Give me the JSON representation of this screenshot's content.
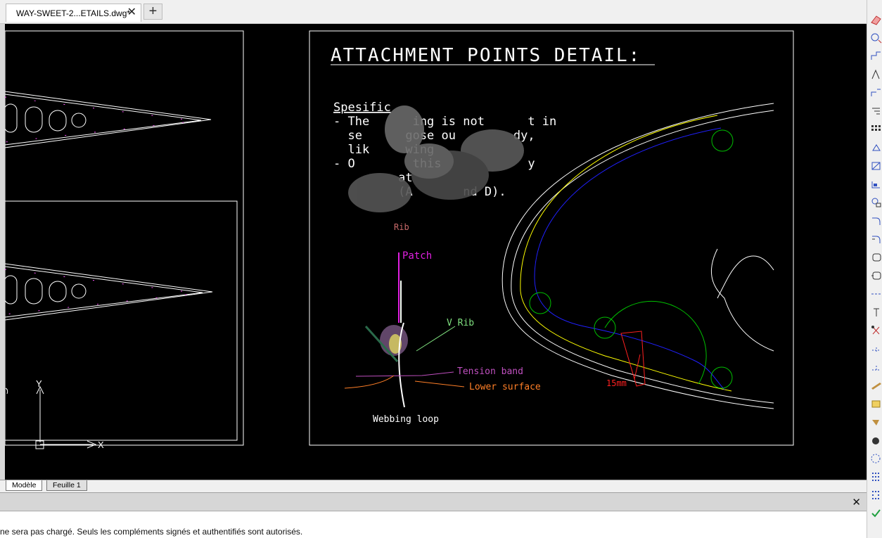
{
  "window": {
    "tab_title": "WAY-SWEET-2...ETAILS.dwg*",
    "close_glyph": "✕",
    "new_tab_glyph": "+"
  },
  "drawing": {
    "detail_title": "ATTACHMENT POINTS DETAIL:",
    "spec_heading": "Spesific",
    "spec_lines": [
      "- The      ing is not      t in",
      "  se      gose ou        dy,",
      "  lik     wing",
      "- O        this            y",
      "         at",
      "         (A       nd D)."
    ],
    "labels": {
      "rib": "Rib",
      "patch": "Patch",
      "v_rib": "V Rib",
      "tension_band": "Tension band",
      "lower_surface": "Lower surface",
      "webbing_loop": "Webbing loop",
      "dimension": "15mm"
    },
    "ucs": {
      "y_label": "Y",
      "x_label": "X"
    },
    "colors": {
      "background": "#000000",
      "outline": "#ffffff",
      "yellow": "#ffff00",
      "blue": "#2020ff",
      "green": "#00c000",
      "magenta": "#e020e0",
      "red": "#ff2020",
      "orange": "#ff7f27",
      "rib_label": "#c86a6a",
      "v_rib_label": "#7fe07f",
      "tension_label": "#c050c0"
    }
  },
  "layout_tabs": {
    "model": "Modèle",
    "sheet1": "Feuille 1"
  },
  "command": {
    "close_glyph": "✕",
    "message": "ne sera pas chargé. Seuls les compléments signés et authentifiés sont autorisés."
  },
  "toolbar": {
    "tools": [
      "erase-icon",
      "copy-icon",
      "mirror-icon",
      "offset-icon",
      "array-icon",
      "move-icon",
      "rotate-icon",
      "scale-icon",
      "stretch-icon",
      "trim-icon",
      "extend-icon",
      "break-icon",
      "join-icon",
      "chamfer-icon",
      "fillet-icon",
      "blend-icon",
      "explode-icon",
      "dimension-icon",
      "hatch-icon",
      "block-icon",
      "point-icon",
      "circle-icon",
      "grid-icon",
      "table-icon",
      "check-icon"
    ]
  }
}
